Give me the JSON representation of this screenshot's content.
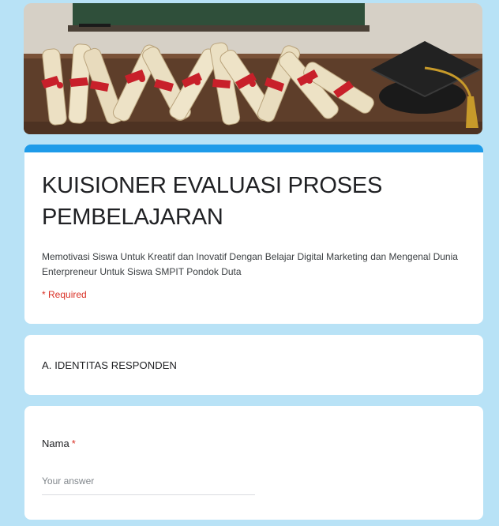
{
  "form": {
    "title": "KUISIONER EVALUASI PROSES PEMBELAJARAN",
    "description": "Memotivasi Siswa Untuk Kreatif dan Inovatif Dengan Belajar Digital Marketing dan Mengenal Dunia Enterpreneur Untuk Siswa SMPIT Pondok Duta",
    "required_note": "* Required"
  },
  "section": {
    "title": "A. IDENTITAS RESPONDEN"
  },
  "questions": [
    {
      "label": "Nama",
      "required_marker": "*",
      "placeholder": "Your answer",
      "value": ""
    }
  ],
  "theme": {
    "accent": "#1e9be9",
    "background": "#b8e2f6",
    "required": "#d93025"
  },
  "header_image": {
    "icon": "graduation-diplomas-and-cap-image"
  }
}
